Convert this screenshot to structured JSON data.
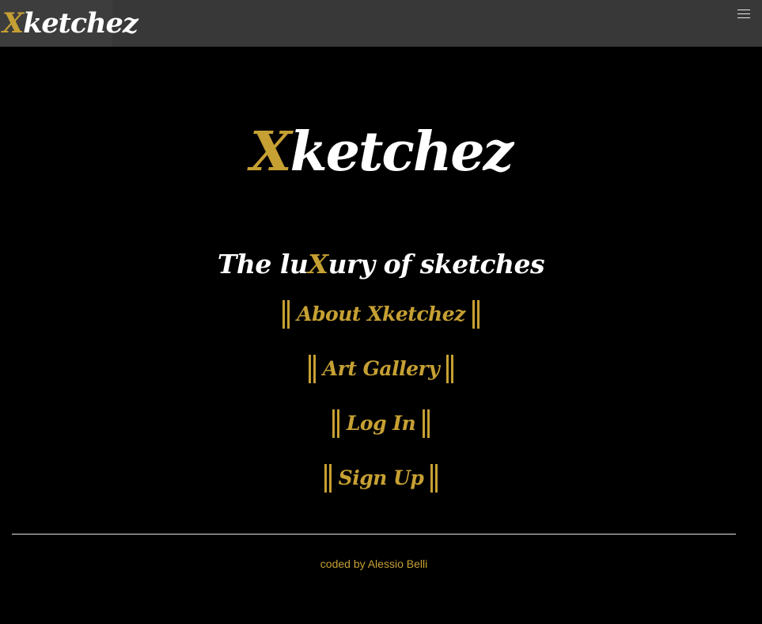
{
  "navbar": {
    "brand_first": "X",
    "brand_rest": "ketchez",
    "menu_icon": "hamburger-icon"
  },
  "hero": {
    "title_first": "X",
    "title_rest": "ketchez",
    "tagline_before": "The lu",
    "tagline_highlight": "X",
    "tagline_after": "ury of sketches"
  },
  "menu": {
    "items": [
      {
        "label": "About Xketchez"
      },
      {
        "label": "Art Gallery"
      },
      {
        "label": "Log In"
      },
      {
        "label": "Sign Up"
      }
    ]
  },
  "footer": {
    "credit": "coded by Alessio Belli"
  },
  "colors": {
    "accent": "#c6a033",
    "background": "#000000",
    "navbar": "#383838",
    "text": "#ffffff"
  }
}
